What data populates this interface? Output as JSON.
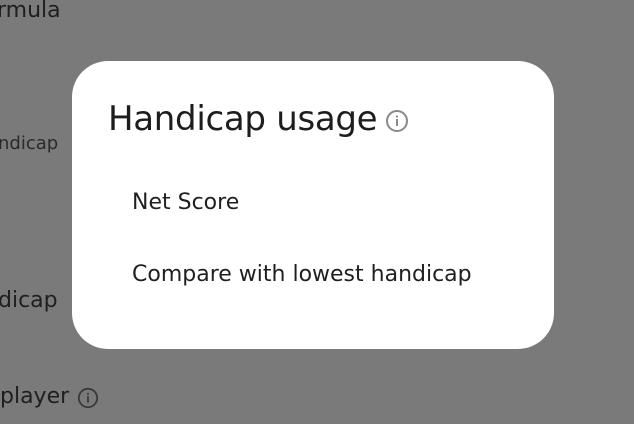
{
  "background": {
    "formula_label": "rmula",
    "handicap_label_small": "ndicap",
    "handicap_label": "dicap",
    "player_label": "player"
  },
  "dialog": {
    "title": "Handicap usage",
    "options": [
      {
        "label": "Net Score"
      },
      {
        "label": "Compare with lowest handicap"
      }
    ]
  },
  "icons": {
    "title_info": "info-icon",
    "player_info": "info-icon"
  },
  "colors": {
    "scrim": "#7a7a7a",
    "dialog_bg": "#ffffff",
    "text": "#1d1d1d",
    "icon": "#8a8a8a"
  }
}
